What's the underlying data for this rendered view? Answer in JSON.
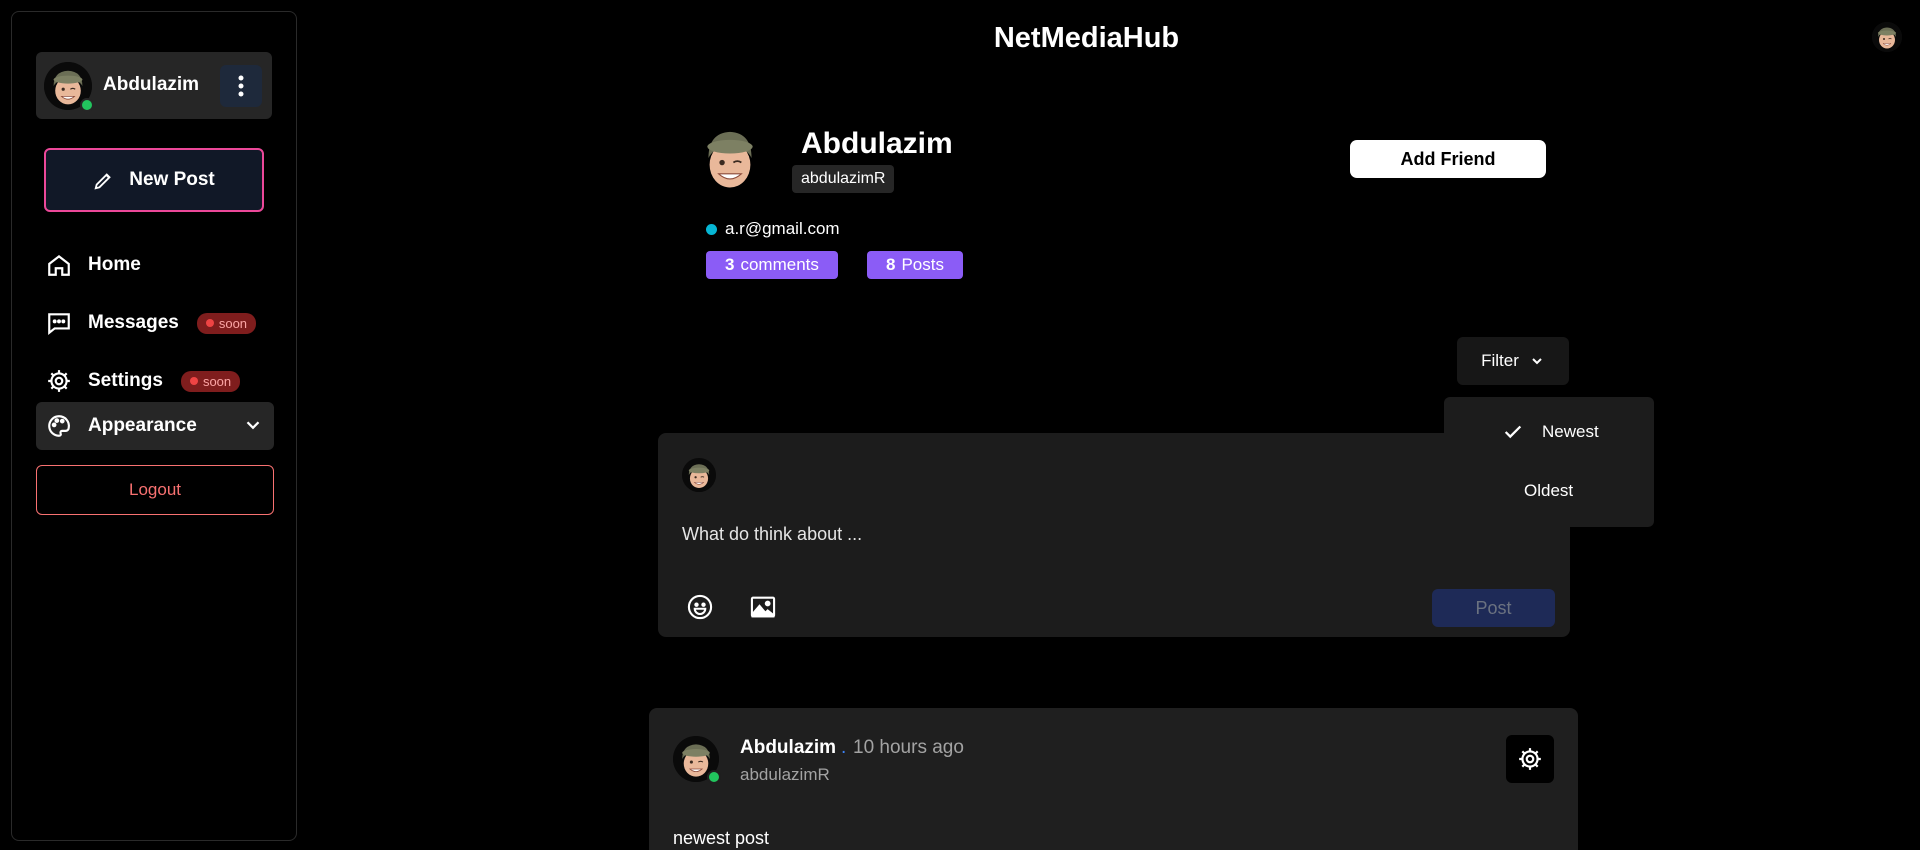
{
  "app": {
    "title": "NetMediaHub"
  },
  "sidebar": {
    "user_name": "Abdulazim",
    "new_post_label": "New Post",
    "items": [
      {
        "label": "Home",
        "icon": "home-icon"
      },
      {
        "label": "Messages",
        "icon": "message-icon",
        "badge": "soon"
      },
      {
        "label": "Settings",
        "icon": "gear-icon",
        "badge": "soon"
      }
    ],
    "appearance_label": "Appearance",
    "logout_label": "Logout"
  },
  "profile": {
    "name": "Abdulazim",
    "handle": "abdulazimR",
    "email": "a.r@gmail.com",
    "add_friend_label": "Add Friend",
    "comments_count": "3",
    "comments_label": "comments",
    "posts_count": "8",
    "posts_label": "Posts"
  },
  "filter": {
    "label": "Filter",
    "options": [
      {
        "label": "Newest",
        "selected": true
      },
      {
        "label": "Oldest",
        "selected": false
      }
    ]
  },
  "composer": {
    "placeholder": "What do think about ...",
    "post_label": "Post"
  },
  "post": {
    "author": "Abdulazim",
    "separator": ".",
    "time": "10 hours ago",
    "handle": "abdulazimR",
    "body": "newest post"
  },
  "colors": {
    "accent_purple": "#8b5cf6",
    "new_post_border": "#ec4899",
    "online": "#22c55e",
    "logout": "#f87171"
  }
}
